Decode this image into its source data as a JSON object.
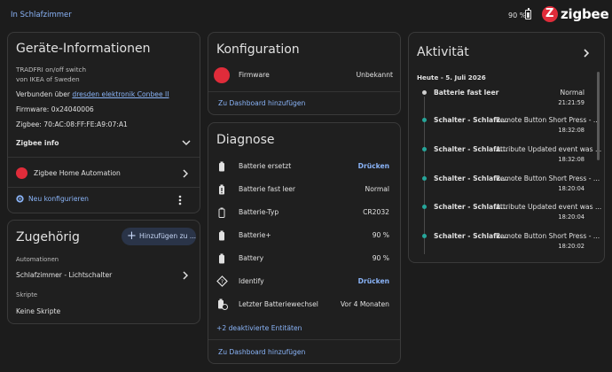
{
  "header": {
    "breadcrumb": "In Schlafzimmer",
    "battery": "90 %",
    "brand": "zigbee",
    "brand_logo_letter": "Z"
  },
  "device_info": {
    "title": "Geräte-Informationen",
    "model": "TRADFRI on/off switch",
    "manufacturer": "von IKEA of Sweden",
    "connected_prefix": "Verbunden über ",
    "connected_link": "dresden elektronik Conbee II",
    "firmware": "Firmware: 0x24040006",
    "zigbee": "Zigbee: 70:AC:08:FF:FE:A9:07:A1",
    "zigbee_info": "Zigbee info",
    "integration": "Zigbee Home Automation",
    "reconfigure": "Neu konfigurieren"
  },
  "related": {
    "title": "Zugehörig",
    "add_button": "Hinzufügen zu ...",
    "automations_header": "Automationen",
    "automation_item": "Schlafzimmer - Lichtschalter",
    "scripts_header": "Skripte",
    "scripts_item": "Keine Skripte"
  },
  "config": {
    "title": "Konfiguration",
    "firmware_label": "Firmware",
    "firmware_value": "Unbekannt",
    "dashboard_link": "Zu Dashboard hinzufügen"
  },
  "diagnose": {
    "title": "Diagnose",
    "rows": [
      {
        "label": "Batterie ersetzt",
        "value": "Drücken",
        "action": true,
        "icon": "battery-replace-icon"
      },
      {
        "label": "Batterie fast leer",
        "value": "Normal",
        "action": false,
        "icon": "battery-alert-icon"
      },
      {
        "label": "Batterie-Typ",
        "value": "CR2032",
        "action": false,
        "icon": "battery-type-icon"
      },
      {
        "label": "Batterie+",
        "value": "90 %",
        "action": false,
        "icon": "battery-plus-icon"
      },
      {
        "label": "Battery",
        "value": "90 %",
        "action": false,
        "icon": "battery-icon"
      },
      {
        "label": "Identify",
        "value": "Drücken",
        "action": true,
        "icon": "identify-icon"
      },
      {
        "label": "Letzter Batteriewechsel",
        "value": "Vor 4 Monaten",
        "action": false,
        "icon": "battery-clock-icon"
      }
    ],
    "disabled_link": "+2 deaktivierte Entitäten",
    "dashboard_link": "Zu Dashboard hinzufügen"
  },
  "activity": {
    "title": "Aktivität",
    "date_header": "Heute - 5. Juli 2026",
    "events": [
      {
        "name": "Batterie fast leer",
        "desc": "",
        "value": "Normal",
        "time": "21:21:59",
        "color": "#cfcfcf"
      },
      {
        "name": "Schalter - Schlafz...",
        "desc": "Remote Button Short Press - ...",
        "value": "",
        "time": "18:32:08",
        "color": "#26a69a"
      },
      {
        "name": "Schalter - Schlafz...",
        "desc": "Attribute Updated event was ...",
        "value": "",
        "time": "18:32:08",
        "color": "#26a69a"
      },
      {
        "name": "Schalter - Schlafz...",
        "desc": "Remote Button Short Press - ...",
        "value": "",
        "time": "18:20:04",
        "color": "#26a69a"
      },
      {
        "name": "Schalter - Schlafz...",
        "desc": "Attribute Updated event was ...",
        "value": "",
        "time": "18:20:04",
        "color": "#26a69a"
      },
      {
        "name": "Schalter - Schlafz...",
        "desc": "Remote Button Short Press - ...",
        "value": "",
        "time": "18:20:02",
        "color": "#26a69a"
      }
    ]
  },
  "colors": {
    "accent": "#8ab4f8",
    "brand": "#e02c3a",
    "teal": "#26a69a"
  }
}
